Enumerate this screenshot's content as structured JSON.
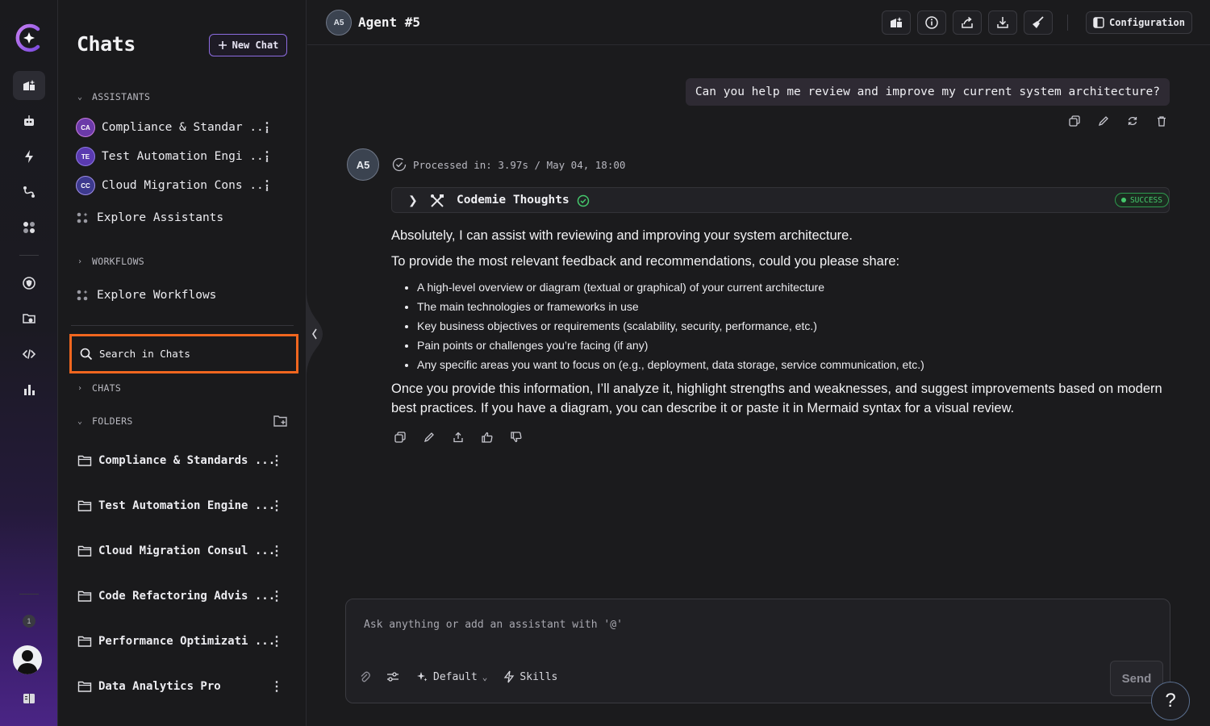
{
  "sidebar": {
    "title": "Chats",
    "new_chat_label": "New Chat",
    "assistants_heading": "ASSISTANTS",
    "assistants": [
      {
        "initials": "CA",
        "name": "Compliance & Standar ..."
      },
      {
        "initials": "TE",
        "name": "Test Automation Engi ..."
      },
      {
        "initials": "CC",
        "name": "Cloud Migration Cons ..."
      }
    ],
    "explore_assistants": "Explore Assistants",
    "workflows_heading": "WORKFLOWS",
    "explore_workflows": "Explore Workflows",
    "search_label": "Search in Chats",
    "chats_heading": "CHATS",
    "folders_heading": "FOLDERS",
    "folders": [
      "Compliance & Standards ...",
      "Test Automation Engine ...",
      "Cloud Migration Consul ...",
      "Code Refactoring Advis ...",
      "Performance Optimizati ...",
      "Data Analytics Pro"
    ]
  },
  "rail": {
    "notification_count": "1"
  },
  "header": {
    "agent_initials": "A5",
    "agent_name": "Agent #5",
    "configuration_label": "Configuration"
  },
  "conversation": {
    "user_message": "Can you help me review and improve my current system architecture?",
    "bot_initials": "A5",
    "processed_text": "Processed in: 3.97s / May 04, 18:00",
    "thoughts_label": "Codemie Thoughts",
    "status_badge": "SUCCESS",
    "reply": {
      "p1": "Absolutely, I can assist with reviewing and improving your system architecture.",
      "p2": "To provide the most relevant feedback and recommendations, could you please share:",
      "bullets": [
        "A high-level overview or diagram (textual or graphical) of your current architecture",
        "The main technologies or frameworks in use",
        "Key business objectives or requirements (scalability, security, performance, etc.)",
        "Pain points or challenges you’re facing (if any)",
        "Any specific areas you want to focus on (e.g., deployment, data storage, service communication, etc.)"
      ],
      "p3": "Once you provide this information, I’ll analyze it, highlight strengths and weaknesses, and suggest improvements based on modern best practices. If you have a diagram, you can describe it or paste it in Mermaid syntax for a visual review."
    }
  },
  "composer": {
    "placeholder": "Ask anything or add an assistant with '@'",
    "model_label": "Default",
    "skills_label": "Skills",
    "send_label": "Send"
  },
  "help_label": "?",
  "colors": {
    "accent_purple": "#8d6ce0",
    "highlight_orange": "#f0661f",
    "success_green": "#45c86c"
  }
}
